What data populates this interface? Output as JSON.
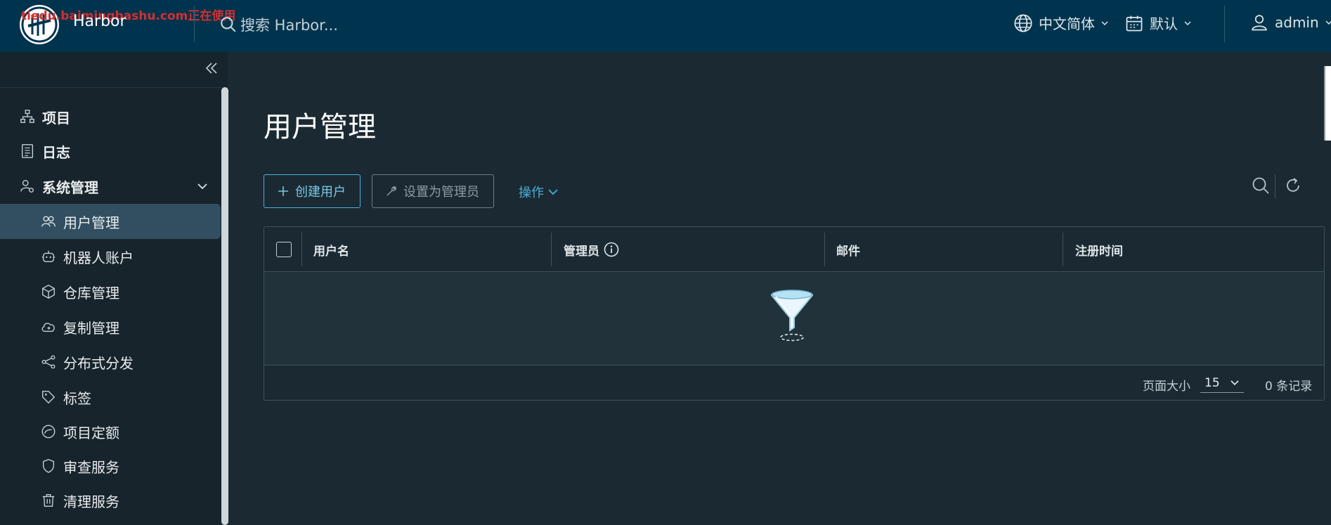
{
  "header": {
    "watermark": "tiedu.baimingbashu.com正在使用",
    "brand": "Harbor",
    "search_placeholder": "搜索 Harbor...",
    "language": "中文简体",
    "datetime_format": "默认",
    "user": "admin"
  },
  "sidebar": {
    "items": [
      {
        "label": "项目",
        "icon": "project-icon"
      },
      {
        "label": "日志",
        "icon": "log-icon"
      },
      {
        "label": "系统管理",
        "icon": "admin-icon"
      }
    ],
    "sub_items": [
      {
        "label": "用户管理",
        "icon": "users-icon",
        "active": true
      },
      {
        "label": "机器人账户",
        "icon": "robot-icon"
      },
      {
        "label": "仓库管理",
        "icon": "registry-icon"
      },
      {
        "label": "复制管理",
        "icon": "replication-icon"
      },
      {
        "label": "分布式分发",
        "icon": "distribution-icon"
      },
      {
        "label": "标签",
        "icon": "tag-icon"
      },
      {
        "label": "项目定额",
        "icon": "quota-icon"
      },
      {
        "label": "审查服务",
        "icon": "shield-icon"
      },
      {
        "label": "清理服务",
        "icon": "trash-icon"
      }
    ]
  },
  "main": {
    "title": "用户管理",
    "create_label": "创建用户",
    "set_admin_label": "设置为管理员",
    "actions_label": "操作"
  },
  "table": {
    "columns": [
      "用户名",
      "管理员",
      "邮件",
      "注册时间"
    ],
    "rows": [],
    "page_size_label": "页面大小",
    "page_size": "15",
    "total": "0 条记录"
  },
  "colors": {
    "header_bg": "#00344e",
    "sidebar_bg": "#17242b",
    "main_bg": "#1b2a32",
    "active_item_bg": "#324f61",
    "accent": "#49afd9",
    "watermark": "#d32f2f"
  }
}
